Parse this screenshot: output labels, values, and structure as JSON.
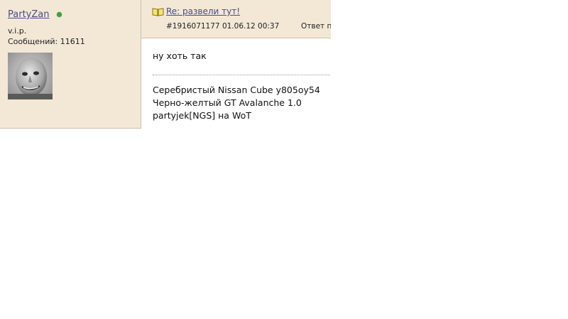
{
  "user": {
    "name": "PartyZan",
    "rank": "v.i.p.",
    "posts_label": "Сообщений: 11611",
    "online_color": "#3aa33a"
  },
  "post": {
    "icon": "open-book-icon",
    "title": "Re: развели тут!",
    "meta": "#1916071177 01.06.12 00:37",
    "reply_label": "Ответ пол",
    "message": "ну хоть так"
  },
  "signature": {
    "lines": [
      "Серебристый Nissan Cube у805оу54",
      "Черно-желтый GT Avalanche 1.0",
      "partyjek[NGS] на WoT"
    ]
  },
  "colors": {
    "panel_bg": "#f3e8d6",
    "link": "#4a4a8a",
    "border": "#cbbfae"
  }
}
